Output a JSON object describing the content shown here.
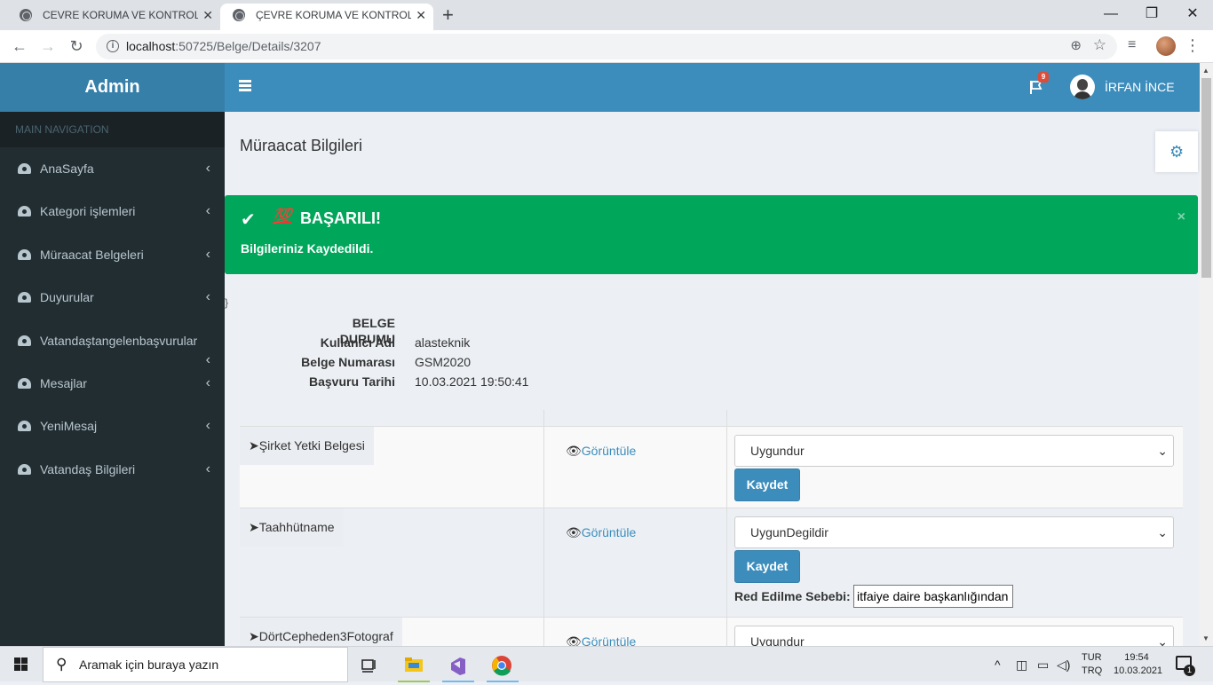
{
  "browser": {
    "tabs": [
      {
        "title": "CEVRE KORUMA VE KONTROL DAİRESİ",
        "active": false
      },
      {
        "title": "ÇEVRE KORUMA VE KONTROL AİRESİ",
        "active": true
      }
    ],
    "close_glyph": "✕",
    "newtab_glyph": "+",
    "window_controls": {
      "minimize": "—",
      "maximize": "❐",
      "close": "✕"
    },
    "url_host": "localhost",
    "url_path": ":50725/Belge/Details/3207"
  },
  "header": {
    "brand": "Admin",
    "notification_count": "9",
    "user_name": "İRFAN İNCE"
  },
  "sidebar": {
    "header": "MAIN NAVIGATION",
    "items": [
      {
        "label": "AnaSayfa"
      },
      {
        "label": "Kategori işlemleri"
      },
      {
        "label": "Müraacat Belgeleri"
      },
      {
        "label": "Duyurular"
      },
      {
        "label": "Vatandaştangelenbaşvurular"
      },
      {
        "label": "Mesajlar"
      },
      {
        "label": "YeniMesaj"
      },
      {
        "label": "Vatandaş Bilgileri"
      }
    ]
  },
  "page": {
    "title": "Müraacat Bilgileri",
    "stray_char": "}"
  },
  "alert": {
    "emoji": "💯",
    "title": "BAŞARILI!",
    "message": "Bilgileriniz Kaydedildi.",
    "close": "×"
  },
  "details": {
    "heading": "BELGE DURUMU",
    "fields": [
      {
        "label": "Kullanıcı Adı",
        "value": "alasteknik"
      },
      {
        "label": "Belge Numarası",
        "value": "GSM2020"
      },
      {
        "label": "Başvuru Tarihi",
        "value": "10.03.2021 19:50:41"
      }
    ]
  },
  "documents": {
    "view_label": "Görüntüle",
    "save_label": "Kaydet",
    "reject_label": "Red Edilme Sebebi:",
    "rows": [
      {
        "name": "➤Şirket Yetki Belgesi",
        "status": "Uygundur"
      },
      {
        "name": "➤Taahhütname",
        "status": "UygunDegildir",
        "reject_reason": "itfaiye daire başkanlığından"
      },
      {
        "name": "➤DörtCepheden3Fotograf",
        "status": "Uygundur"
      }
    ]
  },
  "taskbar": {
    "search_placeholder": "Aramak için buraya yazın",
    "lang_line1": "TUR",
    "lang_line2": "TRQ",
    "time": "19:54",
    "date": "10.03.2021",
    "notification_count": "1"
  },
  "colors": {
    "header_blue": "#3c8dbc",
    "brand_blue": "#367fa9",
    "sidebar_dark": "#222d32",
    "success_green": "#00a65a"
  }
}
